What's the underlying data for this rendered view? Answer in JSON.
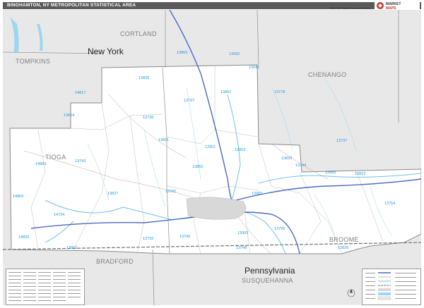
{
  "title": "BINGHAMTON, NY METROPOLITAN STATISTICAL AREA",
  "edition": "2020 ZIP Code Premium Edition",
  "logo": {
    "text_top": "MARKET",
    "text_bottom": "MAPS",
    "icon": "marketmaps-logo-icon"
  },
  "states": [
    {
      "id": "ny",
      "name": "New York"
    },
    {
      "id": "pa",
      "name": "Pennsylvania"
    }
  ],
  "counties": [
    {
      "id": "cortland",
      "name": "CORTLAND"
    },
    {
      "id": "tompkins",
      "name": "TOMPKINS"
    },
    {
      "id": "chenango",
      "name": "CHENANGO"
    },
    {
      "id": "tioga",
      "name": "TIOGA"
    },
    {
      "id": "broome",
      "name": "BROOME"
    },
    {
      "id": "bradford",
      "name": "BRADFORD"
    },
    {
      "id": "susquehanna",
      "name": "SUSQUEHANNA"
    }
  ],
  "zip_codes": [
    "13863",
    "13092",
    "13041",
    "13835",
    "13862",
    "13778",
    "14817",
    "13797",
    "13864",
    "13736",
    "13811",
    "13833",
    "14883",
    "13743",
    "13803",
    "13850",
    "13905",
    "13901",
    "13813",
    "13744",
    "13760",
    "14859",
    "13827",
    "14734",
    "13754",
    "13795",
    "13732",
    "13903",
    "13790",
    "14892",
    "13812",
    "13826",
    "13748",
    "13865",
    "13737"
  ],
  "colors": {
    "background": "#e8e8e8",
    "msa_area": "#ffffff",
    "zip_label": "#1e9be0",
    "water": "#9cd6f0",
    "highway": "#4a6bc6",
    "county_line": "#9a9a9a",
    "title_bar": "#5a5a5a"
  },
  "legend": {
    "icon": "map-legend-icon"
  },
  "compass": {
    "icon": "north-arrow-icon"
  }
}
